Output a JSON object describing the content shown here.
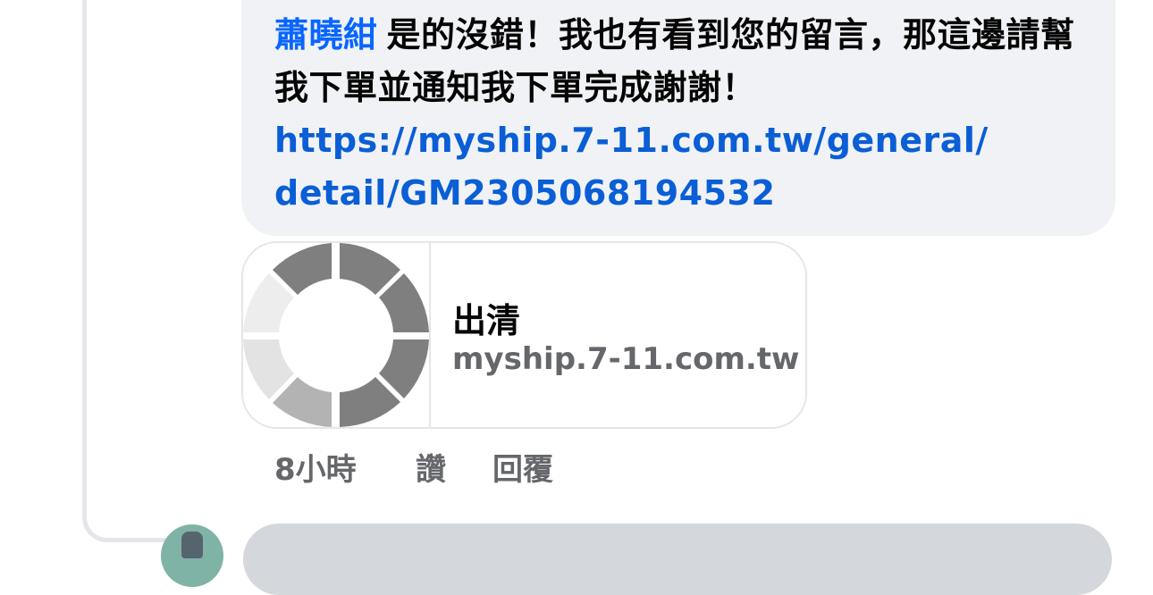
{
  "comment": {
    "mention": "蕭曉紺",
    "body": "是的沒錯！我也有看到您的留言，那這邊請幫我下單並通知我下單完成謝謝！",
    "link": "https://myship.7-11.com.tw/general/detail/GM2305068194532"
  },
  "link_preview": {
    "thumbnail_icon": "loading-spinner-icon",
    "title": "出清",
    "domain": "myship.7-11.com.tw"
  },
  "actions": {
    "time": "8小時",
    "like_label": "讚",
    "reply_label": "回覆"
  },
  "colors": {
    "mention": "#0866ff",
    "link": "#0a5ed6",
    "bubble": "#f0f2f5",
    "muted_text": "#65676b"
  }
}
